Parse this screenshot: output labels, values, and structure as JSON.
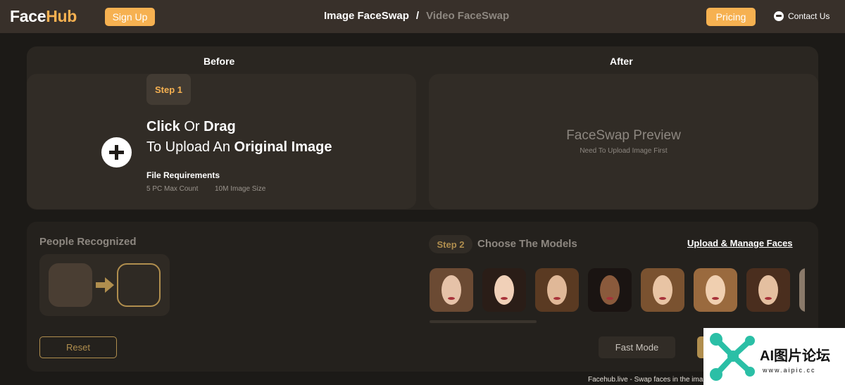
{
  "header": {
    "logo_face": "Face",
    "logo_hub": "Hub",
    "signup_label": "Sign Up",
    "nav_active": "Image FaceSwap",
    "nav_separator": "/",
    "nav_inactive": "Video FaceSwap",
    "pricing_label": "Pricing",
    "contact_label": "Contact Us"
  },
  "upload": {
    "before_title": "Before",
    "after_title": "After",
    "step_label": "Step 1",
    "line1_a": "Click",
    "line1_b": " Or ",
    "line1_c": "Drag",
    "line2_a": "To Upload An ",
    "line2_b": "Original Image",
    "requirements_title": "File Requirements",
    "req_count": "5 PC Max Count",
    "req_size": "10M Image Size"
  },
  "preview": {
    "title": "FaceSwap Preview",
    "subtitle": "Need To Upload Image First"
  },
  "people": {
    "title": "People Recognized"
  },
  "models": {
    "step_label": "Step 2",
    "title": "Choose The Models",
    "manage_label": "Upload & Manage Faces",
    "items": [
      {
        "name": "model-1",
        "hair": "#6b4a33",
        "skin": "#e6c2a8"
      },
      {
        "name": "model-2",
        "hair": "#2a1d17",
        "skin": "#f0d0b8"
      },
      {
        "name": "model-3",
        "hair": "#5a3a22",
        "skin": "#e0b898"
      },
      {
        "name": "model-4",
        "hair": "#1a1412",
        "skin": "#8a5a3c"
      },
      {
        "name": "model-5",
        "hair": "#7a5230",
        "skin": "#e8c4a4"
      },
      {
        "name": "model-6",
        "hair": "#9a6a3e",
        "skin": "#f0cfb0"
      },
      {
        "name": "model-7",
        "hair": "#4a2e1e",
        "skin": "#e4bfa0"
      },
      {
        "name": "model-8",
        "hair": "#8a7a6a",
        "skin": "#d0b49a"
      }
    ]
  },
  "actions": {
    "reset_label": "Reset",
    "fast_mode_label": "Fast Mode"
  },
  "caption": "Facehub.live - Swap faces in the ima",
  "watermark": {
    "text": "AI图片论坛",
    "url": "www.aipic.cc"
  },
  "colors": {
    "accent": "#f6b151",
    "header_bg": "#38302a",
    "page_bg": "#1c1a17"
  }
}
